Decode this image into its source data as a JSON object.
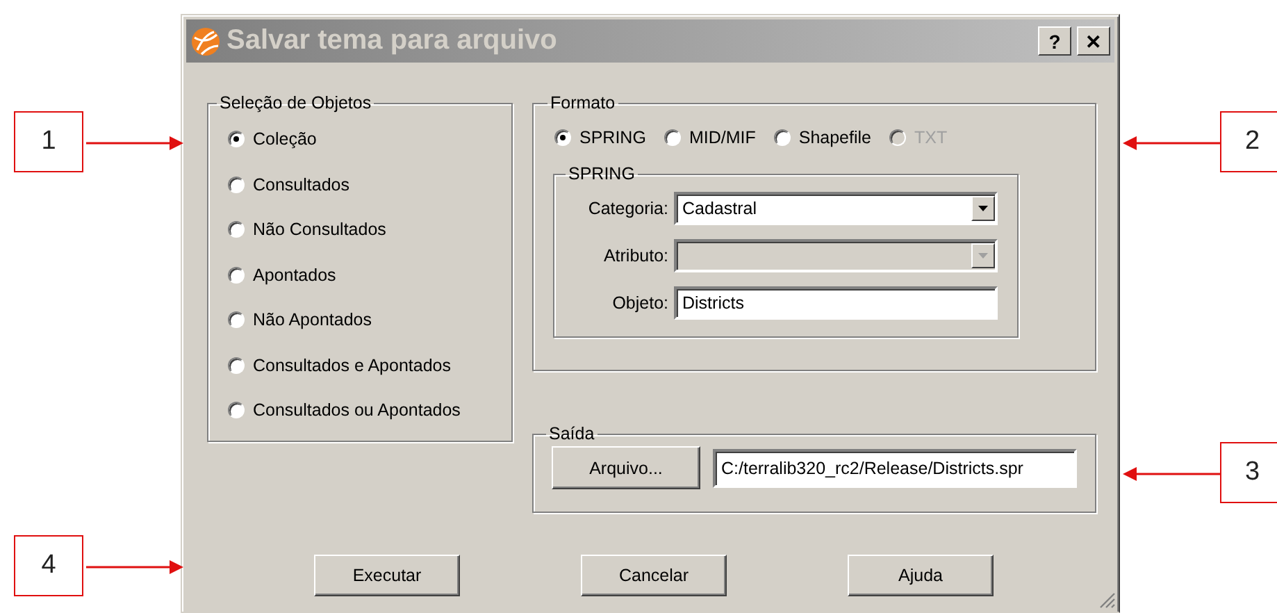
{
  "callouts": [
    {
      "label": "1"
    },
    {
      "label": "2"
    },
    {
      "label": "3"
    },
    {
      "label": "4"
    }
  ],
  "window": {
    "title": "Salvar tema para arquivo",
    "help_button": "?",
    "close_button": "✕"
  },
  "selection": {
    "title": "Seleção de Objetos",
    "options": [
      {
        "label": "Coleção",
        "selected": true
      },
      {
        "label": "Consultados",
        "selected": false
      },
      {
        "label": "Não Consultados",
        "selected": false
      },
      {
        "label": "Apontados",
        "selected": false
      },
      {
        "label": "Não Apontados",
        "selected": false
      },
      {
        "label": "Consultados e Apontados",
        "selected": false
      },
      {
        "label": "Consultados ou Apontados",
        "selected": false
      }
    ]
  },
  "format": {
    "title": "Formato",
    "options": [
      {
        "label": "SPRING",
        "selected": true,
        "disabled": false
      },
      {
        "label": "MID/MIF",
        "selected": false,
        "disabled": false
      },
      {
        "label": "Shapefile",
        "selected": false,
        "disabled": false
      },
      {
        "label": "TXT",
        "selected": false,
        "disabled": true
      }
    ],
    "spring": {
      "title": "SPRING",
      "fields": [
        {
          "kind": "combo",
          "label": "Categoria:",
          "value": "Cadastral",
          "disabled": false
        },
        {
          "kind": "combo",
          "label": "Atributo:",
          "disabled": true
        },
        {
          "kind": "text",
          "label": "Objeto:",
          "value": "Districts"
        }
      ]
    }
  },
  "output": {
    "title": "Saída",
    "button": "Arquivo...",
    "path": "C:/terralib320_rc2/Release/Districts.spr"
  },
  "buttons": [
    "Executar",
    "Cancelar",
    "Ajuda"
  ]
}
